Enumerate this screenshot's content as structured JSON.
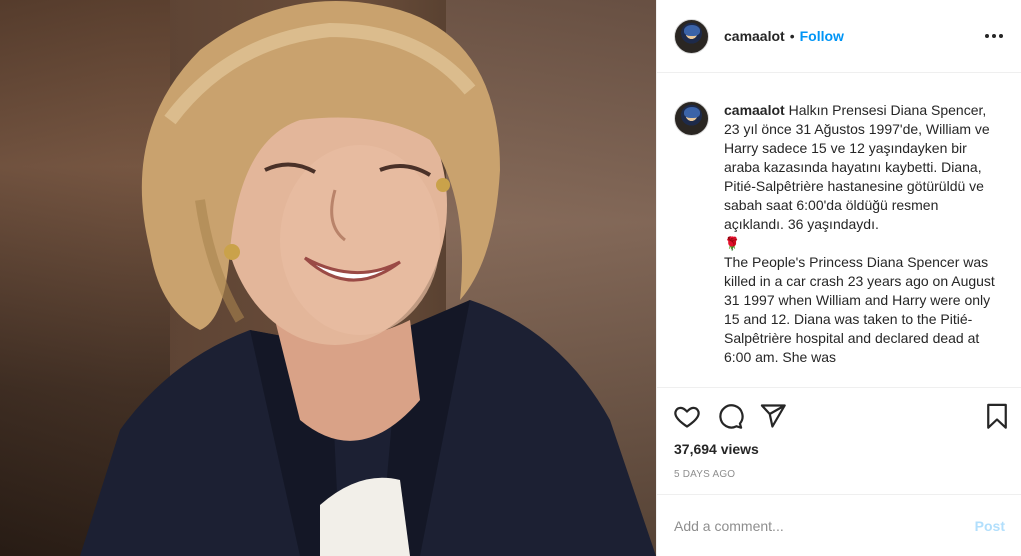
{
  "post": {
    "media_alt": "",
    "header": {
      "username": "camaalot",
      "separator": "•",
      "follow_label": "Follow"
    },
    "caption": {
      "username": "camaalot",
      "text_tr": "Halkın Prensesi Diana Spencer, 23 yıl önce 31 Ağustos 1997'de, William ve Harry sadece 15 ve 12 yaşındayken bir araba kazasında hayatını kaybetti. Diana, Pitié-Salpêtrière hastanesine götürüldü ve sabah saat 6:00'da öldüğü resmen açıklandı. 36 yaşındaydı.",
      "emoji": "🌹",
      "text_en": "The People's Princess Diana Spencer was killed in a car crash 23 years ago on August 31 1997 when William and Harry were only 15 and 12. Diana was taken to the Pitié-Salpêtrière hospital and declared dead at 6:00 am. She was"
    },
    "actions": {
      "like_icon": "heart-icon",
      "comment_icon": "comment-icon",
      "share_icon": "paper-plane-icon",
      "save_icon": "bookmark-icon"
    },
    "views": "37,694 views",
    "time_ago": "5 DAYS AGO",
    "comment": {
      "placeholder": "Add a comment...",
      "post_label": "Post"
    }
  },
  "colors": {
    "link": "#0095f6",
    "post_disabled": "#b2dffc",
    "muted": "#8e8e8e",
    "text": "#262626",
    "border": "#efefef"
  }
}
